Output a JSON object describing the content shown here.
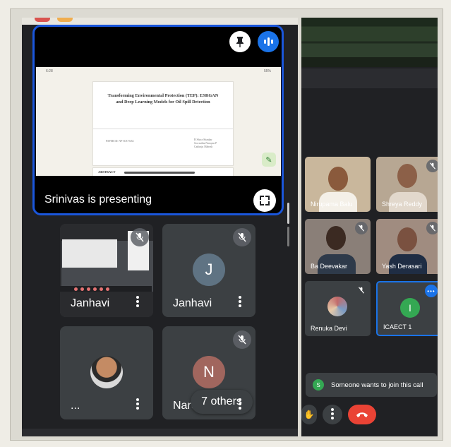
{
  "presenter": {
    "label": "Srinivas is presenting",
    "slide": {
      "status_time": "6:28",
      "status_right": "55%",
      "title": "Transforming Environmental Protection (TEP): ESRGAN and Deep Learning Models for Oil Spill Detection",
      "paper_id": "PAPER ID: NP-ICE-9452",
      "authors": [
        "B Shiva Shankar",
        "Sowmitha Narayan P",
        "Gadiraju Mahesh"
      ],
      "section_label": "ABSTRACT"
    }
  },
  "left_tiles": [
    {
      "name": "Janhavi",
      "type": "screen"
    },
    {
      "name": "Janhavi",
      "type": "letter",
      "letter": "J",
      "color": "#5f7383"
    },
    {
      "name": "...",
      "type": "photo"
    },
    {
      "name": "Nare",
      "type": "letter",
      "letter": "N",
      "color": "#a1665e"
    }
  ],
  "others_pill": "7 others",
  "right_tiles": [
    {
      "name": "Nirupama Balu",
      "type": "photo"
    },
    {
      "name": "Shreya Reddy",
      "type": "photo"
    },
    {
      "name": "Ba Deevakar",
      "type": "photo"
    },
    {
      "name": "Yash Derasari",
      "type": "photo"
    },
    {
      "name": "Renuka Devi",
      "type": "photo"
    },
    {
      "name": "ICAECT 1",
      "type": "letter",
      "letter": "I",
      "color": "#34a853"
    }
  ],
  "join_banner": {
    "avatar_letter": "S",
    "text": "Someone wants to join this call"
  },
  "colors": {
    "accent_blue": "#1a73e8",
    "border_blue": "#1a56db",
    "end_call": "#ea4335"
  }
}
